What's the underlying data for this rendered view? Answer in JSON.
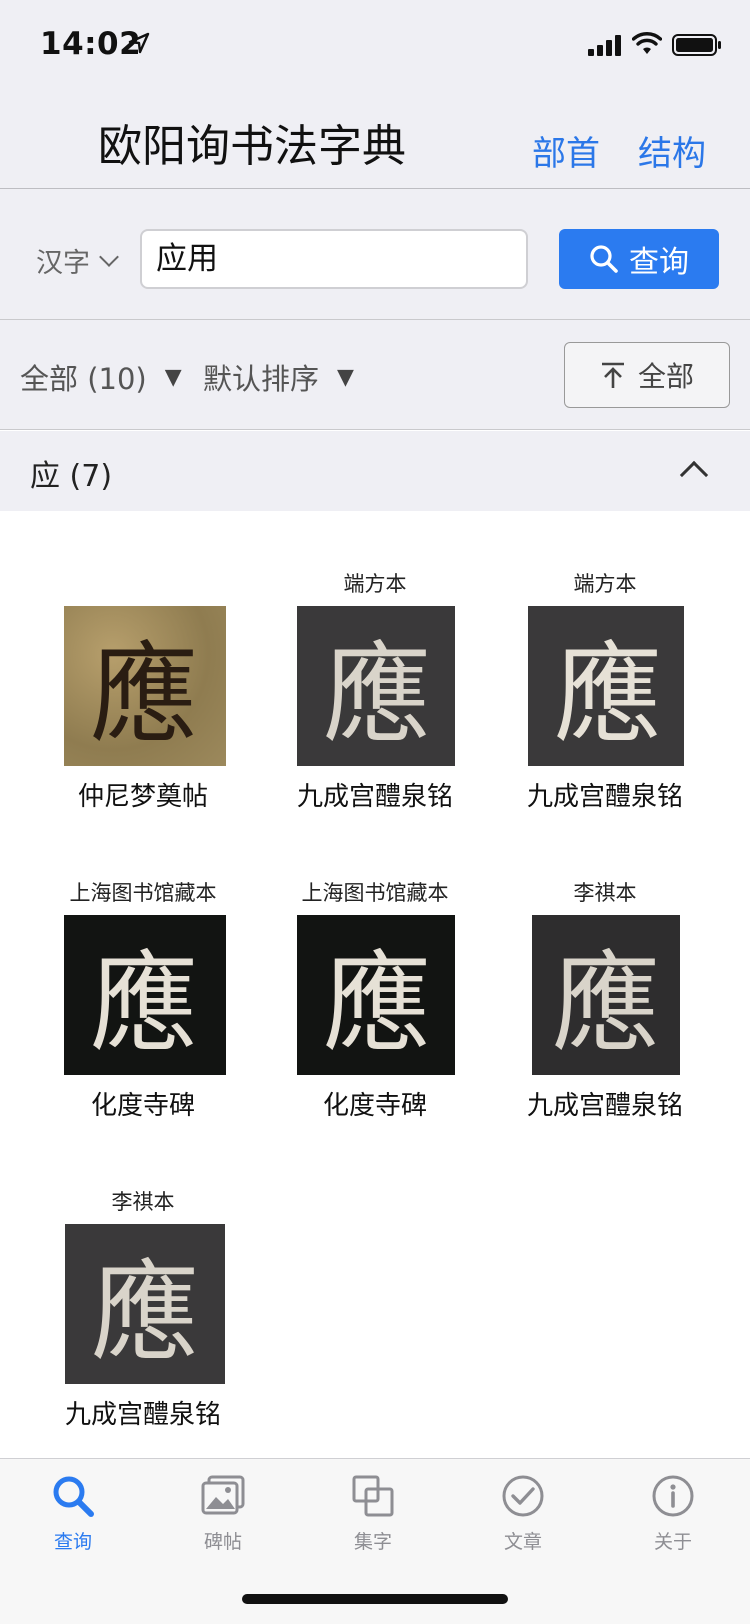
{
  "status_bar": {
    "time": "14:02"
  },
  "header": {
    "title": "欧阳询书法字典",
    "nav_links": [
      "部首",
      "结构"
    ]
  },
  "search": {
    "type": "汉字",
    "value": "应用",
    "button_label": "查询"
  },
  "filters": {
    "scope": "全部 (10)",
    "sort": "默认排序",
    "top_button": "全部"
  },
  "group": {
    "title": "应 (7)"
  },
  "items": [
    {
      "edition": "",
      "source": "仲尼梦奠帖",
      "glyph": "應"
    },
    {
      "edition": "端方本",
      "source": "九成宫醴泉铭",
      "glyph": "應"
    },
    {
      "edition": "端方本",
      "source": "九成宫醴泉铭",
      "glyph": "應"
    },
    {
      "edition": "上海图书馆藏本",
      "source": "化度寺碑",
      "glyph": "應"
    },
    {
      "edition": "上海图书馆藏本",
      "source": "化度寺碑",
      "glyph": "應"
    },
    {
      "edition": "李祺本",
      "source": "九成宫醴泉铭",
      "glyph": "應"
    },
    {
      "edition": "李祺本",
      "source": "九成宫醴泉铭",
      "glyph": "應"
    }
  ],
  "tabs": [
    {
      "label": "查询",
      "icon": "search-icon",
      "active": true
    },
    {
      "label": "碑帖",
      "icon": "photos-icon",
      "active": false
    },
    {
      "label": "集字",
      "icon": "collage-icon",
      "active": false
    },
    {
      "label": "文章",
      "icon": "check-circle-icon",
      "active": false
    },
    {
      "label": "关于",
      "icon": "info-icon",
      "active": false
    }
  ],
  "colors": {
    "accent": "#2b7bf0",
    "nav_link": "#2b77e8",
    "bar_bg": "#efeff4"
  }
}
